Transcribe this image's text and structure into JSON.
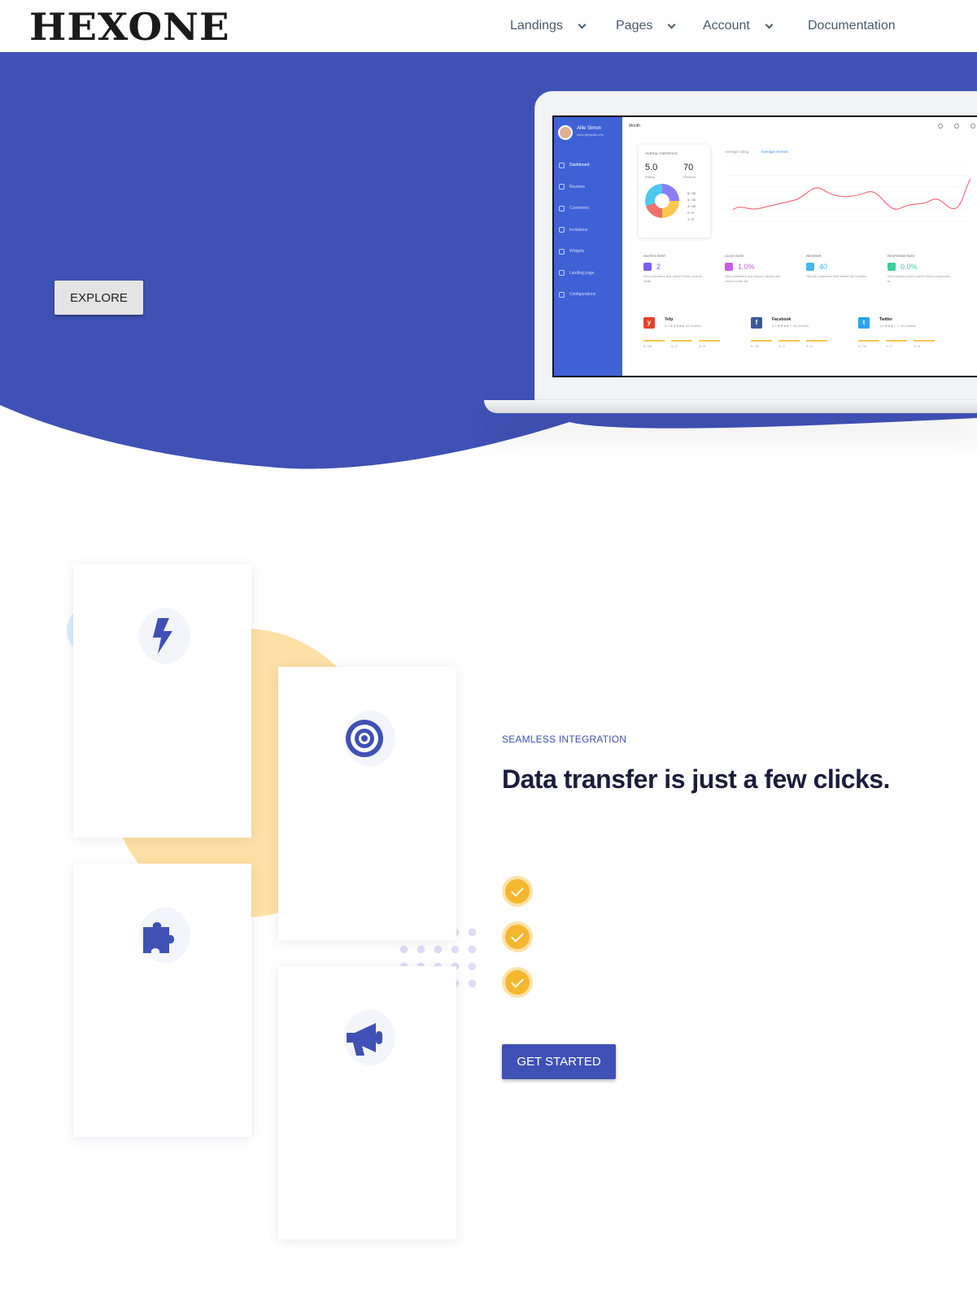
{
  "brand": {
    "logo_text": "HEXONE"
  },
  "nav": {
    "items": [
      {
        "label": "Landings",
        "has_dropdown": true
      },
      {
        "label": "Pages",
        "has_dropdown": true
      },
      {
        "label": "Account",
        "has_dropdown": true
      },
      {
        "label": "Documentation",
        "has_dropdown": false
      }
    ]
  },
  "hero": {
    "explore_label": "EXPLORE",
    "background_color": "#3f51b5"
  },
  "dashboard": {
    "user_name": "Allie Simon",
    "user_email": "simon@gmail.com",
    "menu": [
      "Dashboard",
      "Reviews",
      "Customers",
      "Invitations",
      "Widgets",
      "Landing page",
      "Configurations"
    ],
    "period": "Month",
    "overall_title": "OVERAL STATISTICS",
    "rating_value": "5.0",
    "rating_label": "Rating",
    "reviews_value": "70",
    "reviews_label": "Reviews",
    "legend": [
      "5 / 30",
      "4 / 30",
      "3 / 30",
      "2 / 5",
      "1 / 5"
    ],
    "tab_avg_rating": "Average rating",
    "tab_avg_reviews": "Average reviews",
    "stats": [
      {
        "title": "INVITES SENT",
        "value": "2",
        "sub": "See customers that haven't been sent an invite",
        "color": "#7b5cf0"
      },
      {
        "title": "CLICK RATE",
        "value": "1.0%",
        "sub": "See customers that haven't clicked the review invite link",
        "color": "#c45ee6"
      },
      {
        "title": "REVIEWS",
        "value": "40",
        "sub": "See all customers that leaved the reviews",
        "color": "#3fb6f0"
      },
      {
        "title": "RESPONSE RATE",
        "value": "0.0%",
        "sub": "See reviews which haven't been responded to",
        "color": "#3ccf9a"
      }
    ],
    "socials": [
      {
        "name": "Yelp",
        "rating": "5.0 ★★★★★  40 reviews",
        "color": "#e8402e",
        "glyph": "y"
      },
      {
        "name": "Facebook",
        "rating": "4.0 ★★★★☆  40 reviews",
        "color": "#3b5998",
        "glyph": "f"
      },
      {
        "name": "Twitter",
        "rating": "3.0 ★★★☆☆  40 reviews",
        "color": "#2aa3ef",
        "glyph": "t"
      }
    ]
  },
  "features": {
    "eyebrow": "SEAMLESS INTEGRATION",
    "headline": "Data transfer is just a few clicks.",
    "cta_label": "GET STARTED",
    "icons": [
      "lightning-icon",
      "target-icon",
      "puzzle-icon",
      "megaphone-icon"
    ],
    "accent": "#3f51b5",
    "check_color": "#f5b730"
  }
}
